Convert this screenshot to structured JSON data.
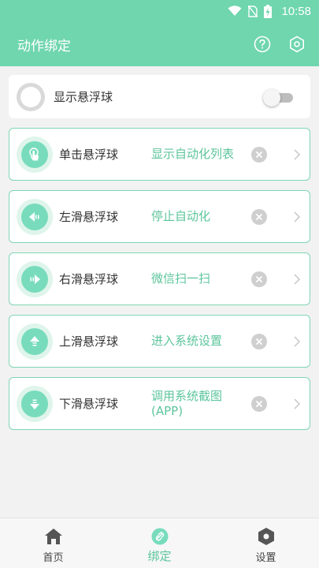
{
  "status_bar": {
    "time": "10:58"
  },
  "app_bar": {
    "title": "动作绑定",
    "help_icon": "help-circle-icon",
    "settings_icon": "hexagon-gear-icon"
  },
  "float_toggle": {
    "label": "显示悬浮球",
    "enabled": false
  },
  "bindings": [
    {
      "gesture": "单击悬浮球",
      "action": "显示自动化列表",
      "icon": "tap-hand-icon"
    },
    {
      "gesture": "左滑悬浮球",
      "action": "停止自动化",
      "icon": "arrow-left-icon"
    },
    {
      "gesture": "右滑悬浮球",
      "action": "微信扫一扫",
      "icon": "arrow-right-icon"
    },
    {
      "gesture": "上滑悬浮球",
      "action": "进入系统设置",
      "icon": "arrow-up-icon"
    },
    {
      "gesture": "下滑悬浮球",
      "action": "调用系统截图\n(APP)",
      "icon": "arrow-down-icon"
    }
  ],
  "bottom_nav": [
    {
      "label": "首页",
      "icon": "home-icon",
      "active": false
    },
    {
      "label": "绑定",
      "icon": "link-icon",
      "active": true
    },
    {
      "label": "设置",
      "icon": "hexagon-gear-icon",
      "active": false
    }
  ],
  "colors": {
    "accent": "#6fd6ae",
    "action_text": "#5cc59c",
    "card_border": "#7fd6b4"
  }
}
